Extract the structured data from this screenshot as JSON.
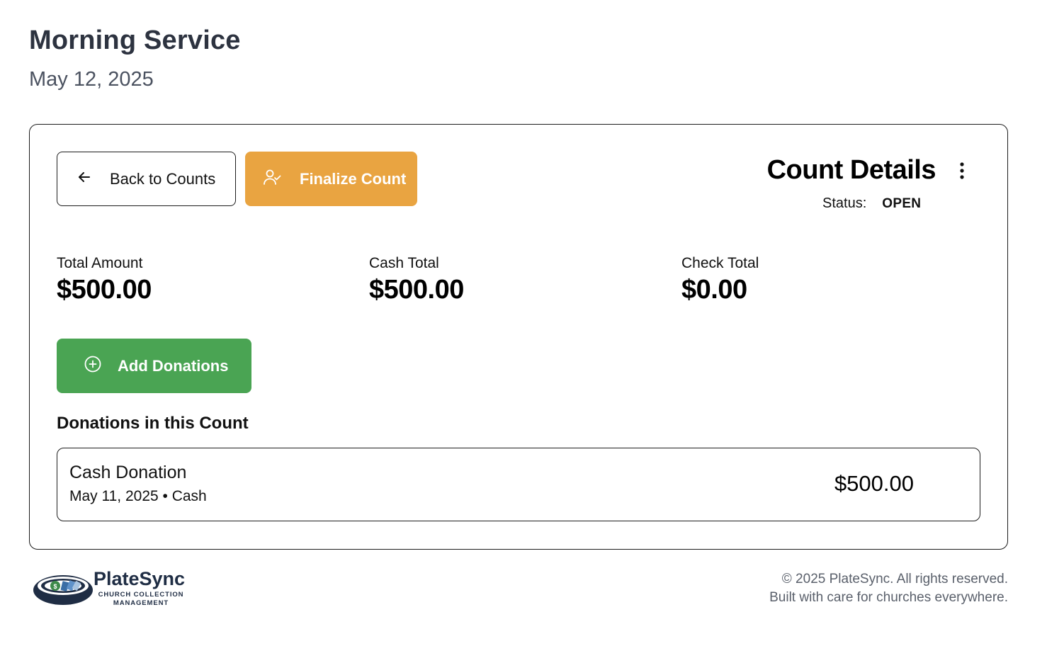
{
  "header": {
    "title": "Morning Service",
    "date": "May 12, 2025"
  },
  "toolbar": {
    "back_label": "Back to Counts",
    "finalize_label": "Finalize Count"
  },
  "details": {
    "title": "Count Details",
    "status_label": "Status:",
    "status_value": "OPEN"
  },
  "stats": {
    "total_label": "Total Amount",
    "total_value": "$500.00",
    "cash_label": "Cash Total",
    "cash_value": "$500.00",
    "check_label": "Check Total",
    "check_value": "$0.00"
  },
  "actions": {
    "add_label": "Add Donations"
  },
  "donations": {
    "heading": "Donations in this Count",
    "items": [
      {
        "title": "Cash Donation",
        "meta": "May 11, 2025 • Cash",
        "amount": "$500.00"
      }
    ]
  },
  "footer": {
    "brand": "PlateSync",
    "tagline_line1": "CHURCH COLLECTION",
    "tagline_line2": "MANAGEMENT",
    "copyright": "© 2025 PlateSync. All rights reserved.",
    "note": "Built with care for churches everywhere."
  },
  "colors": {
    "finalize": "#e9a441",
    "add": "#4aa453",
    "title": "#2d3340",
    "logo_navy": "#1f2d44"
  },
  "icons": {
    "back": "arrow-left-icon",
    "finalize": "user-check-icon",
    "add": "plus-circle-icon",
    "menu": "more-vertical-icon"
  }
}
